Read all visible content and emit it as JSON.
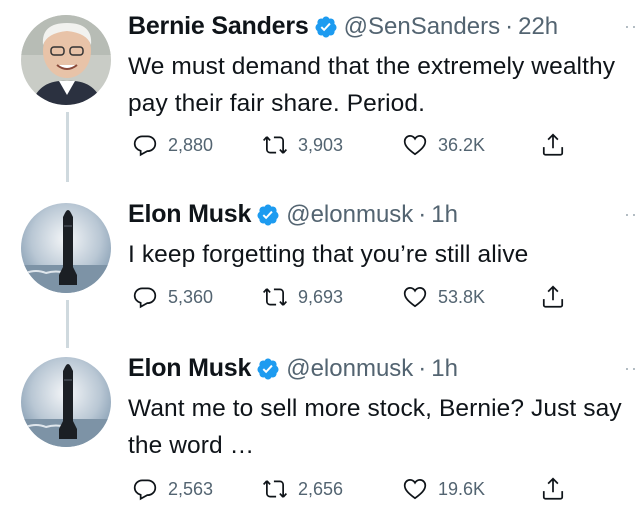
{
  "tweets": [
    {
      "name": "Bernie Sanders",
      "handle": "@SenSanders",
      "separator": "·",
      "time": "22h",
      "text": "We must demand that the extremely wealthy pay their fair share. Period.",
      "replies": "2,880",
      "retweets": "3,903",
      "likes": "36.2K"
    },
    {
      "name": "Elon Musk",
      "handle": "@elonmusk",
      "separator": "·",
      "time": "1h",
      "text": "I keep forgetting that you’re still alive",
      "replies": "5,360",
      "retweets": "9,693",
      "likes": "53.8K"
    },
    {
      "name": "Elon Musk",
      "handle": "@elonmusk",
      "separator": "·",
      "time": "1h",
      "text": "Want me to sell more stock, Bernie? Just say the word …",
      "replies": "2,563",
      "retweets": "2,656",
      "likes": "19.6K"
    }
  ],
  "icons": {
    "verified": "verified-badge-icon",
    "reply": "reply-icon",
    "retweet": "retweet-icon",
    "like": "heart-icon",
    "share": "share-icon",
    "more": "more-options-icon"
  },
  "colors": {
    "verified_blue": "#1d9bf0",
    "secondary_text": "#536471",
    "primary_text": "#0f1419",
    "thread_line": "#cfd9de"
  }
}
